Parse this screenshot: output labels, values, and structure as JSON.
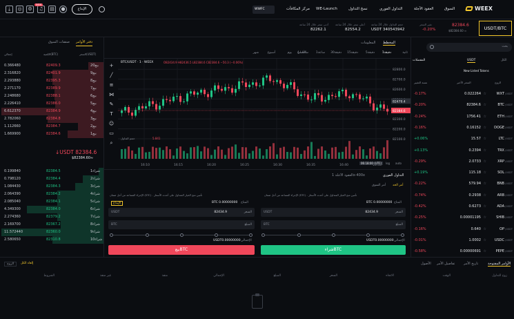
{
  "topbar": {
    "login_label": "الإيداع",
    "badge": "NEW",
    "wwfc": "WWFC",
    "nav": [
      "مركز المكافآت",
      "WE-Launch",
      "نسخ التداول",
      "التداول الفوري",
      "العقود الآجلة",
      "السوق"
    ],
    "logo": "WEEX"
  },
  "ticker": {
    "pair": "USDT/BTC",
    "price": "82384.6",
    "price_sub": "$82384.60 ≈",
    "change_label": "تغير السعر",
    "change": "-0.20%",
    "stats": [
      {
        "label": "أعلى سعر خلال 24 ساعة",
        "value": "82554.2"
      },
      {
        "label": "أدنى سعر خلال 24 ساعة",
        "value": "82262.1"
      },
      {
        "label": "حجم التداول خلال 24 ساعة",
        "value": "USDT 340543942"
      }
    ]
  },
  "orderbook": {
    "tabs": [
      "دفتر الأوامر",
      "صفقات السوق"
    ],
    "headers": [
      "السعر(USDT)",
      "الكمية(BTC)",
      "إجمالي"
    ],
    "asks": [
      {
        "price": "82409.3",
        "qty": "0.366480",
        "total": "2بيع0"
      },
      {
        "price": "82401.9",
        "qty": "2.316820",
        "total": "9بيع"
      },
      {
        "price": "82395.3",
        "qty": "2.293880",
        "total": "8بيع"
      },
      {
        "price": "82389.9",
        "qty": "2.271170",
        "total": "7بيع"
      },
      {
        "price": "82388.1",
        "qty": "2.248680",
        "total": "6بيع"
      },
      {
        "price": "82386.0",
        "qty": "2.226410",
        "total": "5بيع"
      },
      {
        "price": "82384.9",
        "qty": "6.612370",
        "total": "4بيع"
      },
      {
        "price": "82384.8",
        "qty": "2.782060",
        "total": "3بيع"
      },
      {
        "price": "82384.7",
        "qty": "1.112660",
        "total": "2بيع"
      },
      {
        "price": "82384.6",
        "qty": "1.669900",
        "total": "1بيع"
      }
    ],
    "ask_depth": [
      0.15,
      0.5,
      0.5,
      0.48,
      0.48,
      0.47,
      1.0,
      0.55,
      0.25,
      0.35
    ],
    "mid_price": "↓USDT 82384.6",
    "mid_sub": "$82384.60≈",
    "bids": [
      {
        "price": "82384.5",
        "qty": "0.199840",
        "total": "شراء1"
      },
      {
        "price": "82384.4",
        "qty": "0.798120",
        "total": "شراء2"
      },
      {
        "price": "82384.3",
        "qty": "1.084430",
        "total": "شراء3"
      },
      {
        "price": "82384.2",
        "qty": "2.064390",
        "total": "شراء4"
      },
      {
        "price": "82384.1",
        "qty": "2.085040",
        "total": "شراء5"
      },
      {
        "price": "82384.0",
        "qty": "4.349300",
        "total": "شراء6"
      },
      {
        "price": "82379.2",
        "qty": "2.274360",
        "total": "شراء7"
      },
      {
        "price": "82367.2",
        "qty": "2.169700",
        "total": "شراء8"
      },
      {
        "price": "82360.0",
        "qty": "11.572440",
        "total": "شراء9"
      },
      {
        "price": "82310.8",
        "qty": "2.580650",
        "total": "شراء10"
      }
    ],
    "bid_depth": [
      0.05,
      0.2,
      0.28,
      0.45,
      0.45,
      0.75,
      0.45,
      0.42,
      1.0,
      0.5
    ]
  },
  "chart": {
    "tabs": [
      "المخطط",
      "المعلومات"
    ],
    "intervals": [
      "ثانية",
      "1دقيقة",
      "5دقيقة",
      "15دقيقة",
      "30دقيقة",
      "1ساعة",
      "4ساعات",
      "يوم",
      "أسبوع",
      "شهر"
    ],
    "style": "الأصلي",
    "legend": "BTC/USDT · 1 · WEEX",
    "ohlc": "O82434.9 H82436.5 L82384.6 C82384.6 −50.3 (−0.06%)",
    "vol_label": "حجم التداول",
    "vol_value": "5.841",
    "price_axis": [
      "82800.0",
      "82700.0",
      "82600.0",
      "82500.0",
      "82400.0",
      "82300.0",
      "82200.0",
      "82100.0"
    ],
    "last_price_tag": "82384.6",
    "mark_tag": "82479.4",
    "time_axis": [
      "16:10",
      "16:15",
      "16:20",
      "16:25",
      "16:30",
      "16:35",
      "16:40",
      "16:45"
    ],
    "time_readout": "06:18:00 (UTC)",
    "log_label": "log",
    "auto_label": "auto",
    "tool_icons": [
      "crosshair-icon",
      "trend-line-icon",
      "fib-icon",
      "pattern-icon",
      "brush-icon",
      "text-icon",
      "smile-icon",
      "ruler-icon",
      "zoom-icon"
    ]
  },
  "chart_data": {
    "type": "line",
    "title": "BTC/USDT · 1 · WEEX",
    "x": [
      "16:10",
      "16:15",
      "16:20",
      "16:25",
      "16:30",
      "16:35",
      "16:40",
      "16:45"
    ],
    "series": [
      {
        "values": [
          82360,
          82460,
          82560,
          82620,
          82700,
          82500,
          82560,
          82380
        ]
      }
    ],
    "ylim": [
      82100,
      82850
    ],
    "grid": true
  },
  "trade": {
    "tabs": [
      "التداول الفوري",
      "العقود الآجلة 1x-400x"
    ],
    "order_types": [
      "أمر الحد",
      "أمر السوق"
    ],
    "note": "الإجراء المساعد من أجل ضمان (STC) . تأمين منح الخيار المتداول على أحدث الأسعار",
    "available_label": "المتاح",
    "buy_available": "BTC 0.00000000",
    "sell_available": "BTC 0.00000000",
    "deposit": "الإيداع",
    "price_label": "السعر",
    "price_value": "82434.9",
    "price_unit": "USDT",
    "qty_label": "المبلغ",
    "qty_unit": "BTC",
    "total_label": "الإجمالي",
    "total_value": "USDT0.00000000",
    "buy_btn": "شراءBTC",
    "sell_btn": "بيعBTC"
  },
  "markets": {
    "search_placeholder": "بحث",
    "tabs": [
      "المفضلات",
      "USDT"
    ],
    "subtab": "New Listed Tokens",
    "all": "الكل",
    "headers": [
      "الزوج",
      "السعر الأخير",
      "نسبة التغيير"
    ],
    "rows": [
      {
        "sym": "WXT",
        "quote": "/USDT",
        "price": "0.022264",
        "chg": "-0.17%",
        "up": false
      },
      {
        "sym": "BTC",
        "quote": "/USDT",
        "price": "82384.6",
        "chg": "-0.20%",
        "up": false
      },
      {
        "sym": "ETH",
        "quote": "/USDT",
        "price": "1756.41",
        "chg": "-0.24%",
        "up": false
      },
      {
        "sym": "DOGE",
        "quote": "/USDT",
        "price": "0.16152",
        "chg": "-0.16%",
        "up": false
      },
      {
        "sym": "LTC",
        "quote": "/USDT",
        "price": "15.57",
        "chg": "+0.06%",
        "up": true
      },
      {
        "sym": "TRX",
        "quote": "/USDT",
        "price": "0.2394",
        "chg": "+0.13%",
        "up": true
      },
      {
        "sym": "XRP",
        "quote": "/USDT",
        "price": "2.0733",
        "chg": "-0.29%",
        "up": false
      },
      {
        "sym": "SOL",
        "quote": "/USDT",
        "price": "115.18",
        "chg": "+0.19%",
        "up": true
      },
      {
        "sym": "BNB",
        "quote": "/USDT",
        "price": "579.94",
        "chg": "-0.22%",
        "up": false
      },
      {
        "sym": "ARB",
        "quote": "/USDT",
        "price": "0.2938",
        "chg": "-0.74%",
        "up": false
      },
      {
        "sym": "ADA",
        "quote": "/USDT",
        "price": "0.6273",
        "chg": "-0.42%",
        "up": false
      },
      {
        "sym": "SHIB",
        "quote": "/USDT",
        "price": "0.00001195",
        "chg": "-0.25%",
        "up": false
      },
      {
        "sym": "OP",
        "quote": "/USDT",
        "price": "0.640",
        "chg": "-0.16%",
        "up": false
      },
      {
        "sym": "USDC",
        "quote": "/USDT",
        "price": "1.0002",
        "chg": "-0.01%",
        "up": false
      },
      {
        "sym": "PEPE",
        "quote": "/USDT",
        "price": "0.00000691",
        "chg": "-0.58%",
        "up": false
      }
    ]
  },
  "bottom": {
    "tabs": [
      "الأوامر المفتوحة",
      "تاريخ الأمر",
      "تفاصيل الأمر",
      "الأصول"
    ],
    "cancel_all": "إلغاء الكل",
    "filter": "الزوج",
    "columns": [
      "زوج التداول",
      "الوقت",
      "الاتجاه",
      "السعر",
      "المبلغ",
      "الإجمالي",
      "منفذ",
      "غير منفذ",
      "الشروط"
    ]
  },
  "colors": {
    "up": "#1fc485",
    "down": "#f0475a",
    "accent": "#f3c72c"
  }
}
